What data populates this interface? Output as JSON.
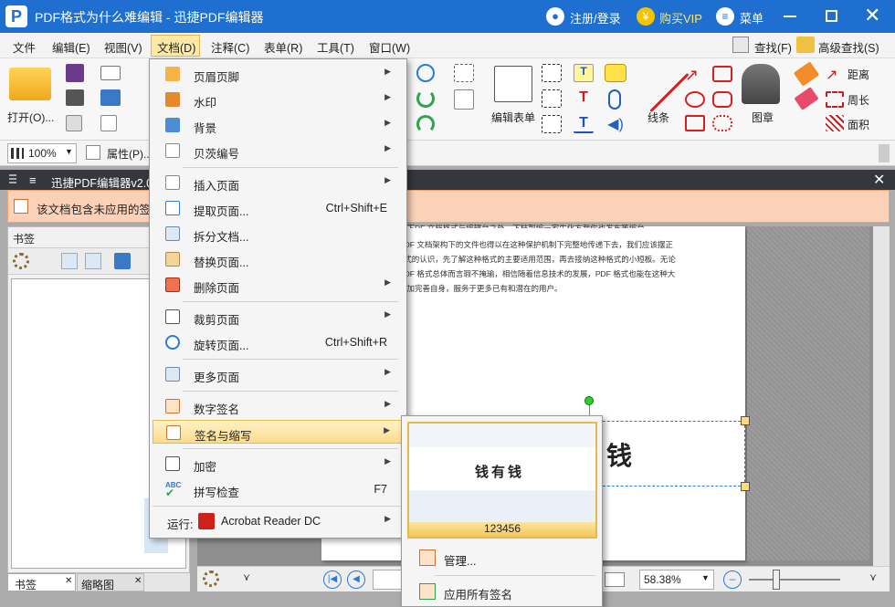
{
  "app": {
    "title": "PDF格式为什么难编辑 - 迅捷PDF编辑器",
    "login": "注册/登录",
    "vip": "购买VIP",
    "menu": "菜单"
  },
  "menubar": [
    "文件",
    "编辑(E)",
    "视图(V)",
    "文档(D)",
    "注释(C)",
    "表单(R)",
    "工具(T)",
    "窗口(W)"
  ],
  "rightbar": {
    "find": "查找(F)",
    "adv_find": "高级查找(S)"
  },
  "ribbon": {
    "open": "打开(O)...",
    "edit_form": "编辑表单",
    "line": "线条",
    "stamp": "图章",
    "distance": "距离",
    "perimeter": "周长",
    "area": "面积"
  },
  "toolbar2": {
    "zoom": "100%",
    "properties": "属性(P)..."
  },
  "doctab": {
    "title": "迅捷PDF编辑器v2.0"
  },
  "notice": {
    "text": "该文档包含未应用的签"
  },
  "leftpanel": {
    "title": "书签",
    "tabs": [
      "书签",
      "缩略图"
    ]
  },
  "document": {
    "lines": [
      "下安。下DF 文档格式与编辑台之处。下档到编一家生化方我你也发布等编台，...",
      "件、PDF 文档架构下的文件也得以在这种保护机制下完整地传递下去，我们应该摆正",
      "DF 格式的认识，先了解这种格式的主要适用范围，再去接纳这种格式的小短板。无论",
      "段，PDF 格式总体而言瑕不掩瑜，相信随着信息技术的发展，PDF 格式也能在这种大",
      "之下更加完善自身，服务于更多已有和潜在的用户。"
    ],
    "signature": "钱"
  },
  "bottombar": {
    "zoom": "58.38%"
  },
  "menu": {
    "items": [
      {
        "label": "页眉页脚",
        "shortcut": "",
        "arrow": true
      },
      {
        "label": "水印",
        "shortcut": "",
        "arrow": true
      },
      {
        "label": "背景",
        "shortcut": "",
        "arrow": true
      },
      {
        "label": "贝茨编号",
        "shortcut": "",
        "arrow": true
      },
      {
        "label": "插入页面",
        "shortcut": "",
        "arrow": true
      },
      {
        "label": "提取页面...",
        "shortcut": "Ctrl+Shift+E",
        "arrow": false
      },
      {
        "label": "拆分文档...",
        "shortcut": "",
        "arrow": false
      },
      {
        "label": "替换页面...",
        "shortcut": "",
        "arrow": false
      },
      {
        "label": "删除页面",
        "shortcut": "",
        "arrow": true
      },
      {
        "label": "裁剪页面",
        "shortcut": "",
        "arrow": true
      },
      {
        "label": "旋转页面...",
        "shortcut": "Ctrl+Shift+R",
        "arrow": false
      },
      {
        "label": "更多页面",
        "shortcut": "",
        "arrow": true
      },
      {
        "label": "数字签名",
        "shortcut": "",
        "arrow": true
      },
      {
        "label": "签名与缩写",
        "shortcut": "",
        "arrow": true
      },
      {
        "label": "加密",
        "shortcut": "",
        "arrow": true
      },
      {
        "label": "拼写检查",
        "shortcut": "F7",
        "arrow": false
      }
    ],
    "run": {
      "label": "运行:",
      "app": "Acrobat Reader DC"
    }
  },
  "submenu": {
    "signature_text": "钱有钱",
    "signature_name": "123456",
    "manage": "管理...",
    "apply_all": "应用所有签名"
  },
  "colors": {
    "title_bg": "#1e6fd0",
    "highlight": "#fbdc8e",
    "notice_bg": "#fbd2b8"
  }
}
